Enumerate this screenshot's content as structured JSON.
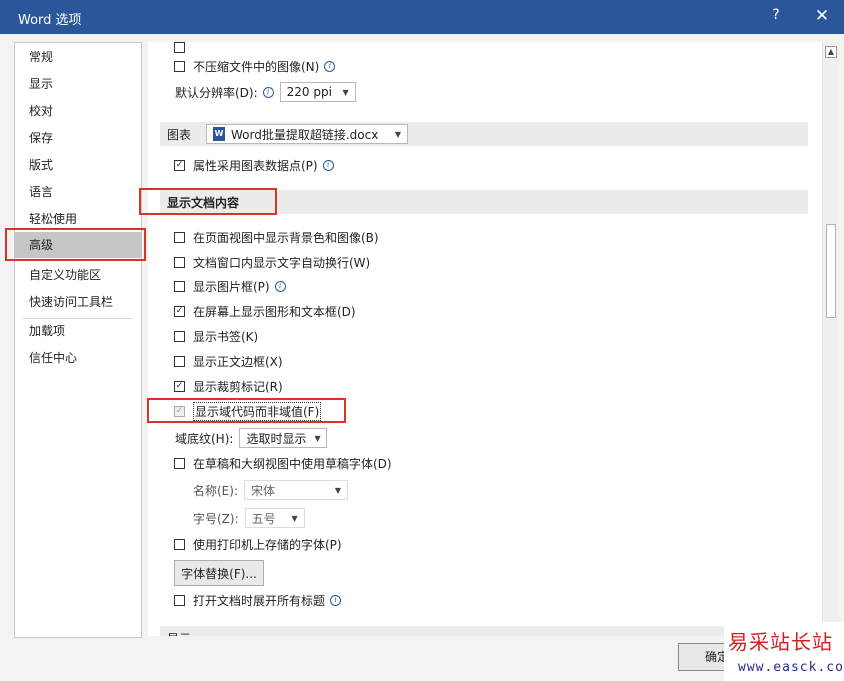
{
  "window": {
    "title": "Word 选项",
    "help_label": "?",
    "close_label": "✕"
  },
  "nav": {
    "items": [
      {
        "label": "常规"
      },
      {
        "label": "显示"
      },
      {
        "label": "校对"
      },
      {
        "label": "保存"
      },
      {
        "label": "版式"
      },
      {
        "label": "语言"
      },
      {
        "label": "轻松使用"
      },
      {
        "label": "高级",
        "selected": true
      },
      {
        "label": "自定义功能区"
      },
      {
        "label": "快速访问工具栏"
      },
      {
        "label": "加载项"
      },
      {
        "label": "信任中心"
      }
    ]
  },
  "options": {
    "no_compress": {
      "label": "不压缩文件中的图像(N)",
      "checked": false
    },
    "default_resolution": {
      "label": "默认分辨率(D):",
      "value": "220 ppi"
    },
    "chart_section": {
      "label": "图表",
      "doc_name": "Word批量提取超链接.docx"
    },
    "chart_data_point": {
      "label": "属性采用图表数据点(P)",
      "checked": true
    },
    "show_doc_content": {
      "heading": "显示文档内容"
    },
    "show_bg_color": {
      "label": "在页面视图中显示背景色和图像(B)",
      "checked": false
    },
    "wrap_text": {
      "label": "文档窗口内显示文字自动换行(W)",
      "checked": false
    },
    "picture_placeholder": {
      "label": "显示图片框(P)",
      "checked": false
    },
    "drawings_textboxes": {
      "label": "在屏幕上显示图形和文本框(D)",
      "checked": true
    },
    "bookmarks": {
      "label": "显示书签(K)",
      "checked": false
    },
    "text_boundaries": {
      "label": "显示正文边框(X)",
      "checked": false
    },
    "crop_marks": {
      "label": "显示裁剪标记(R)",
      "checked": true
    },
    "field_codes": {
      "label": "显示域代码而非域值(F)",
      "checked": true
    },
    "field_shading": {
      "label": "域底纹(H):",
      "value": "选取时显示"
    },
    "draft_font": {
      "label": "在草稿和大纲视图中使用草稿字体(D)",
      "checked": false
    },
    "font_name": {
      "label": "名称(E):",
      "value": "宋体"
    },
    "font_size": {
      "label": "字号(Z):",
      "value": "五号"
    },
    "printer_fonts": {
      "label": "使用打印机上存储的字体(P)",
      "checked": false
    },
    "font_substitution_button": "字体替换(F)...",
    "expand_headings": {
      "label": "打开文档时展开所有标题",
      "checked": false
    },
    "next_section": "显示"
  },
  "footer": {
    "ok_label": "确定"
  },
  "watermark": {
    "text": "易采站长站",
    "url": "www.easck.com"
  }
}
